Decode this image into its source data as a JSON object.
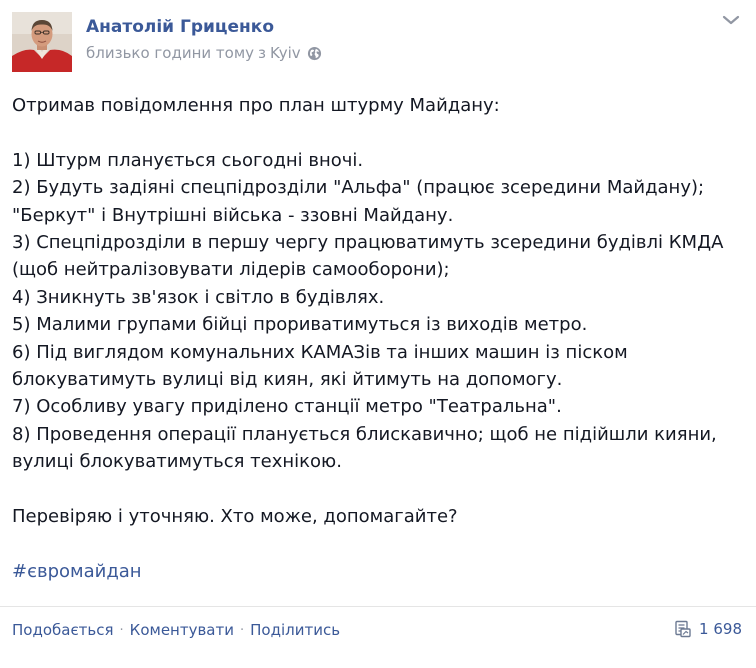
{
  "post": {
    "author": "Анатолій Гриценко",
    "time": "близько години тому",
    "location_prefix": "з",
    "location": "Kyiv",
    "lines": {
      "l0": "Отримав повідомлення про план штурму Майдану:",
      "l1": "1) Штурм планується сьогодні вночі.",
      "l2": "2) Будуть задіяні спецпідрозділи \"Альфа\" (працює зсередини Майдану);",
      "l3": "\"Беркут\" і Внутрішні війська - ззовні Майдану.",
      "l4": "3) Спецпідрозділи в першу чергу працюватимуть зсередини будівлі КМДА",
      "l5": "(щоб нейтралізовувати лідерів самооборони);",
      "l6": "4) Зникнуть зв'язок і світло в будівлях.",
      "l7": "5) Малими групами бійці прориватимуться із виходів метро.",
      "l8": "6) Під виглядом комунальних КАМАЗів та інших машин із піском",
      "l9": "блокуватимуть вулиці від киян, які йтимуть на допомогу.",
      "l10": "7) Особливу увагу приділено станції метро \"Театральна\".",
      "l11": "8) Проведення операції планується блискавично; щоб не підійшли кияни,",
      "l12": "вулиці блокуватимуться технікою.",
      "l13": "Перевіряю і уточняю. Хто може, допомагайте?"
    },
    "hashtag": "#євромайдан"
  },
  "actions": {
    "like": "Подобається",
    "comment": "Коментувати",
    "share": "Поділитись",
    "separator": "·"
  },
  "shares_count": "1 698",
  "colors": {
    "link": "#3b5998",
    "meta": "#9197a3",
    "text": "#141823"
  },
  "icons": {
    "globe": "globe-icon",
    "menu": "chevron-down-icon",
    "shares": "share-icon"
  }
}
